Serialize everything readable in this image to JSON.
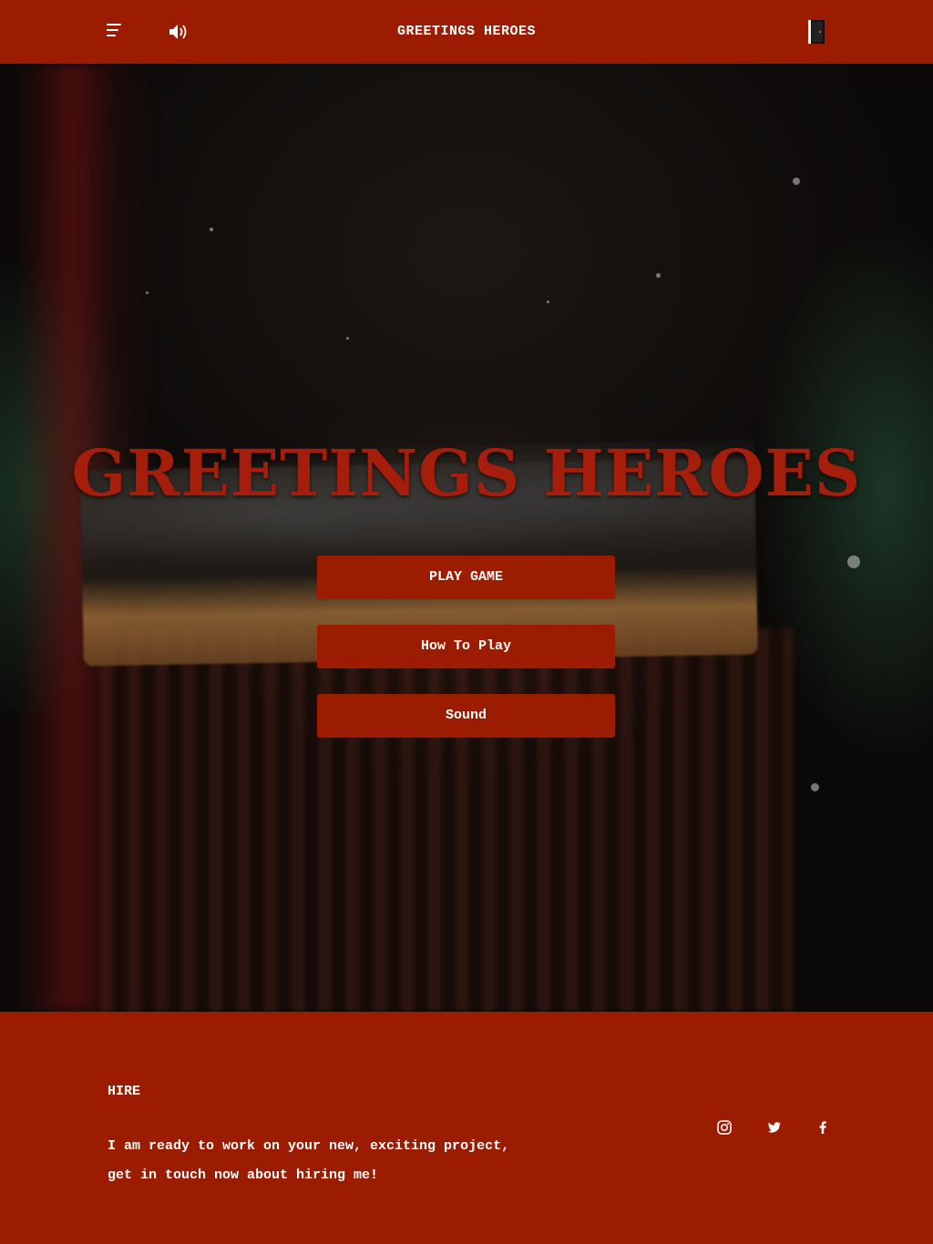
{
  "header": {
    "title": "GREETINGS HEROES",
    "menu_icon": "hamburger-menu-icon",
    "sound_icon": "speaker-volume-icon",
    "exit_icon": "exit-door-icon"
  },
  "hero": {
    "title": "GREETINGS HEROES",
    "buttons": [
      {
        "label": "PLAY GAME"
      },
      {
        "label": "How To Play"
      },
      {
        "label": "Sound"
      }
    ]
  },
  "footer": {
    "heading": "HIRE",
    "text_line1": "I am ready to work on your new, exciting project,",
    "text_line2": "get in touch now about hiring me!",
    "social": [
      "instagram-icon",
      "twitter-icon",
      "facebook-icon"
    ]
  },
  "colors": {
    "brand_red": "#9b1c00",
    "title_red": "#a51d0b",
    "text": "#ffffff"
  }
}
